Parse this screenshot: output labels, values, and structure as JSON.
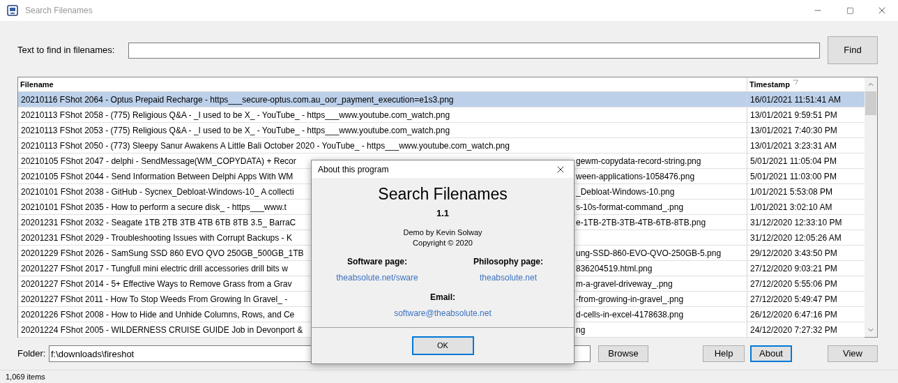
{
  "window": {
    "title": "Search Filenames"
  },
  "search": {
    "label": "Text to find in filenames:",
    "button": "Find"
  },
  "table": {
    "columns": [
      {
        "label": "Filename",
        "sorted": false
      },
      {
        "label": "Timestamp",
        "sorted": true
      }
    ],
    "rows": [
      {
        "filename": "20210116 FShot 2064 - Optus Prepaid Recharge - https___secure-optus.com.au_oor_payment_execution=e1s3.png",
        "timestamp": "16/01/2021 11:51:41 AM",
        "selected": true
      },
      {
        "filename": "20210113 FShot 2058 - (775) Religious Q&A - _I used to be X_ - YouTube_ - https___www.youtube.com_watch.png",
        "timestamp": "13/01/2021 9:59:51 PM",
        "selected": false
      },
      {
        "filename": "20210113 FShot 2053 - (775) Religious Q&A - _I used to be X_ - YouTube_ - https___www.youtube.com_watch.png",
        "timestamp": "13/01/2021 7:40:30 PM",
        "selected": false
      },
      {
        "filename": "20210113 FShot 2050 - (773) Sleepy Sanur Awakens A Little Bali October 2020 - YouTube_ - https___www.youtube.com_watch.png",
        "timestamp": "13/01/2021 3:23:31 AM",
        "selected": false
      },
      {
        "filename_left": "20210105 FShot 2047 - delphi - SendMessage(WM_COPYDATA) + Recor",
        "filename_right": "gewm-copydata-record-string.png",
        "timestamp": "5/01/2021 11:05:04 PM",
        "selected": false
      },
      {
        "filename_left": "20210105 FShot 2044 - Send Information Between Delphi Apps With WM",
        "filename_right": "ween-applications-1058476.png",
        "timestamp": "5/01/2021 11:03:00 PM",
        "selected": false
      },
      {
        "filename_left": "20210101 FShot 2038 - GitHub - Sycnex_Debloat-Windows-10_ A collecti",
        "filename_right": "_Debloat-Windows-10.png",
        "timestamp": "1/01/2021 5:53:08 PM",
        "selected": false
      },
      {
        "filename_left": "20210101 FShot 2035 - How to perform a secure disk_ - https___www.t",
        "filename_right": "s-10s-format-command_.png",
        "timestamp": "1/01/2021 3:02:10 AM",
        "selected": false
      },
      {
        "filename_left": "20201231 FShot 2032 - Seagate 1TB 2TB 3TB 4TB 6TB 8TB 3.5_ BarraC",
        "filename_right": "e-1TB-2TB-3TB-4TB-6TB-8TB.png",
        "timestamp": "31/12/2020 12:33:10 PM",
        "selected": false
      },
      {
        "filename_left": "20201231 FShot 2029 - Troubleshooting Issues with Corrupt Backups - K",
        "timestamp": "31/12/2020 12:05:26 AM",
        "selected": false
      },
      {
        "filename_left": "20201229 FShot 2026 - SamSung SSD 860 EVO QVO 250GB_500GB_1TB",
        "filename_right": "ung-SSD-860-EVO-QVO-250GB-5.png",
        "timestamp": "29/12/2020 3:43:50 PM",
        "selected": false
      },
      {
        "filename_left": "20201227 FShot 2017 - Tungfull mini electric drill accessories drill bits w",
        "filename_right": "836204519.html.png",
        "timestamp": "27/12/2020 9:03:21 PM",
        "selected": false
      },
      {
        "filename_left": "20201227 FShot 2014 - 5+ Effective Ways to Remove Grass from a Grav",
        "filename_right": "m-a-gravel-driveway_.png",
        "timestamp": "27/12/2020 5:55:06 PM",
        "selected": false
      },
      {
        "filename_left": "20201227 FShot 2011 - How To Stop Weeds From Growing In Gravel_ -",
        "filename_right": "-from-growing-in-gravel_.png",
        "timestamp": "27/12/2020 5:49:47 PM",
        "selected": false
      },
      {
        "filename_left": "20201226 FShot 2008 - How to Hide and Unhide Columns, Rows, and Ce",
        "filename_right": "d-cells-in-excel-4178638.png",
        "timestamp": "26/12/2020 6:47:16 PM",
        "selected": false
      },
      {
        "filename_left": "20201224 FShot 2005 - WILDERNESS CRUISE GUIDE Job in Devonport &",
        "filename_right": "ng",
        "timestamp": "24/12/2020 7:27:32 PM",
        "selected": false
      }
    ]
  },
  "folder": {
    "label": "Folder:",
    "value": "f:\\downloads\\fireshot",
    "button": "Browse"
  },
  "buttons": [
    {
      "label": "Help",
      "focused": false
    },
    {
      "label": "About",
      "focused": true
    },
    {
      "label": "View",
      "focused": false
    }
  ],
  "status_bar": {
    "text": "1,069 items"
  },
  "dialog": {
    "title": "About this program",
    "app_name": "Search Filenames",
    "version": "1.1",
    "credit": "Demo by Kevin Solway",
    "copyright": "Copyright © 2020",
    "links": [
      {
        "label": "Software page:",
        "url": "theabsolute.net/sware"
      },
      {
        "label": "Philosophy page:",
        "url": "theabsolute.net"
      }
    ],
    "email": {
      "label": "Email:",
      "url": "software@theabsolute.net"
    },
    "ok": "OK"
  }
}
